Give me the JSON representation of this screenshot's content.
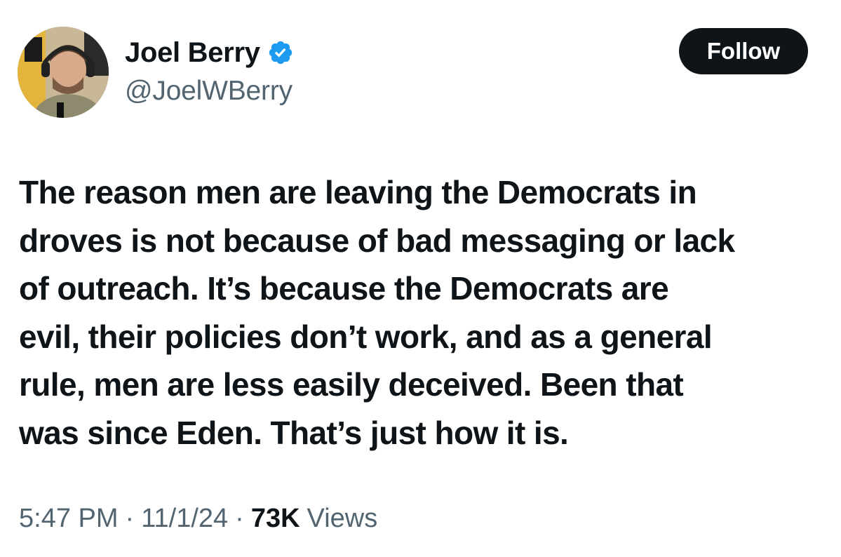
{
  "author": {
    "display_name": "Joel Berry",
    "handle": "@JoelWBerry",
    "verified": true,
    "avatar_icon": "profile-photo"
  },
  "follow_label": "Follow",
  "tweet": {
    "lines": [
      "The reason men are leaving the Democrats in",
      "droves is not because of bad messaging or lack",
      "of outreach. It’s because the Democrats are",
      "evil, their policies don’t work, and as a general",
      "rule, men are less easily deceived. Been that",
      "was since Eden. That’s just how it is."
    ]
  },
  "meta": {
    "time": "5:47 PM",
    "separator": "·",
    "date": "11/1/24",
    "views_count": "73K",
    "views_label": "Views"
  },
  "colors": {
    "text_primary": "#0f1419",
    "text_secondary": "#536471",
    "verified_blue": "#1d9bf0",
    "follow_bg": "#0f1419",
    "follow_text": "#ffffff"
  }
}
